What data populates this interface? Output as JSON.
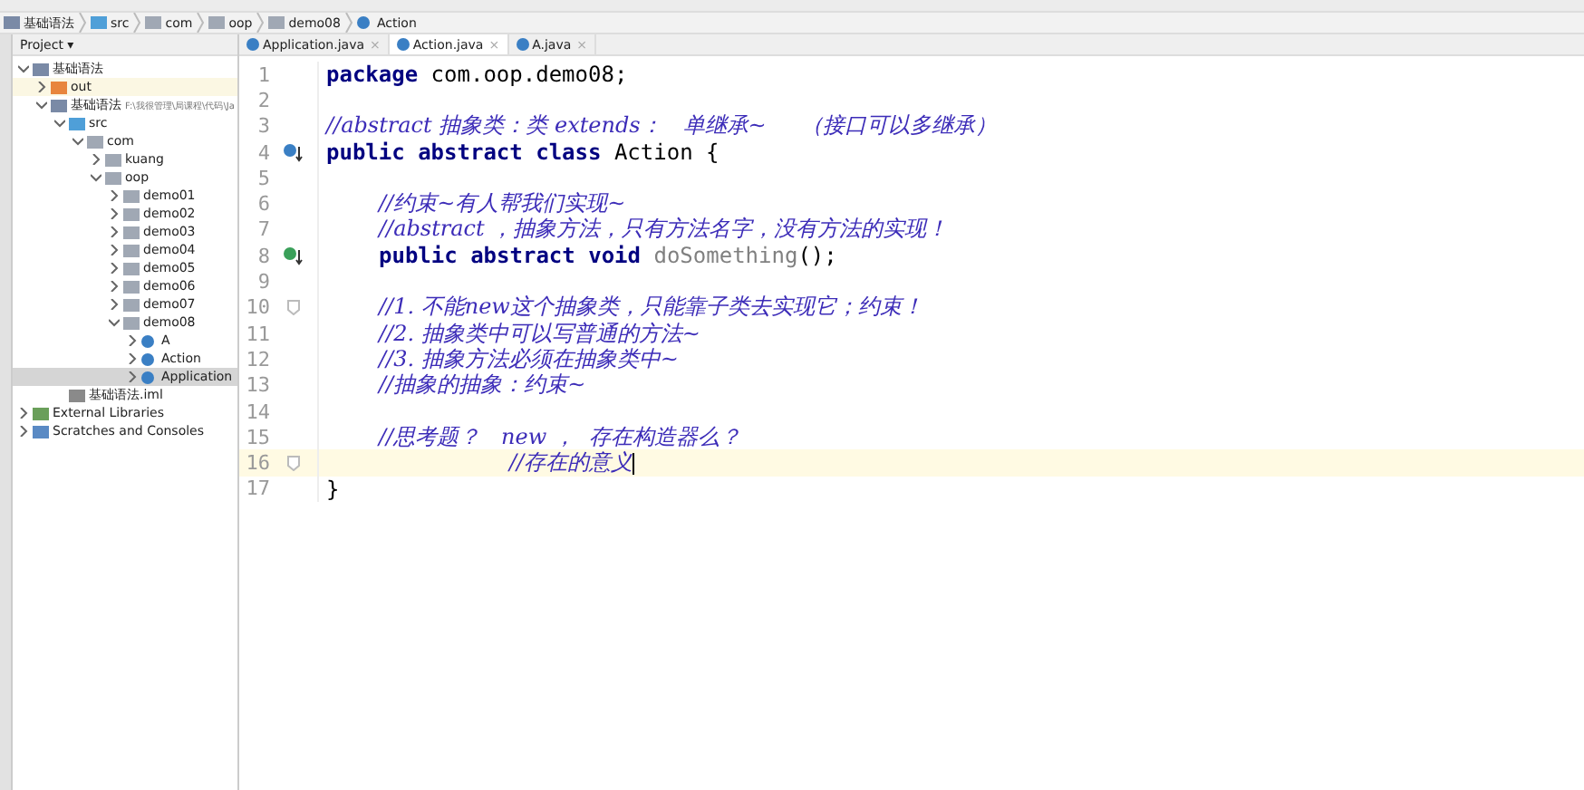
{
  "breadcrumb": [
    {
      "label": "基础语法",
      "kind": "module"
    },
    {
      "label": "src",
      "kind": "src"
    },
    {
      "label": "com",
      "kind": "package"
    },
    {
      "label": "oop",
      "kind": "package"
    },
    {
      "label": "demo08",
      "kind": "package"
    },
    {
      "label": "Action",
      "kind": "class"
    }
  ],
  "project_panel": {
    "title": "Project",
    "menu_arrow": "▾",
    "tree": [
      {
        "label": "基础语法",
        "kind": "module",
        "expanded": true,
        "selected": false,
        "children": [
          {
            "label": "out",
            "kind": "excluded",
            "expanded": false,
            "selected": false
          },
          {
            "label": "基础语法",
            "path": "F:\\我很管理\\局课程\\代码\\Ja",
            "kind": "module",
            "expanded": true,
            "selected": false,
            "children": [
              {
                "label": "src",
                "kind": "src",
                "expanded": true,
                "selected": false,
                "children": [
                  {
                    "label": "com",
                    "kind": "package",
                    "expanded": true,
                    "selected": false,
                    "children": [
                      {
                        "label": "kuang",
                        "kind": "package",
                        "expanded": false,
                        "selected": false
                      },
                      {
                        "label": "oop",
                        "kind": "package",
                        "expanded": true,
                        "selected": false,
                        "children": [
                          {
                            "label": "demo01",
                            "kind": "package",
                            "expanded": false,
                            "selected": false
                          },
                          {
                            "label": "demo02",
                            "kind": "package",
                            "expanded": false,
                            "selected": false
                          },
                          {
                            "label": "demo03",
                            "kind": "package",
                            "expanded": false,
                            "selected": false
                          },
                          {
                            "label": "demo04",
                            "kind": "package",
                            "expanded": false,
                            "selected": false
                          },
                          {
                            "label": "demo05",
                            "kind": "package",
                            "expanded": false,
                            "selected": false
                          },
                          {
                            "label": "demo06",
                            "kind": "package",
                            "expanded": false,
                            "selected": false
                          },
                          {
                            "label": "demo07",
                            "kind": "package",
                            "expanded": false,
                            "selected": false
                          },
                          {
                            "label": "demo08",
                            "kind": "package",
                            "expanded": true,
                            "selected": false,
                            "children": [
                              {
                                "label": "A",
                                "kind": "class",
                                "expanded": false,
                                "selected": false
                              },
                              {
                                "label": "Action",
                                "kind": "class",
                                "expanded": false,
                                "selected": false
                              },
                              {
                                "label": "Application",
                                "kind": "class",
                                "expanded": false,
                                "selected": true
                              }
                            ]
                          }
                        ]
                      }
                    ]
                  }
                ]
              },
              {
                "label": "基础语法.iml",
                "kind": "file",
                "leaf": true,
                "selected": false
              }
            ]
          }
        ]
      },
      {
        "label": "External Libraries",
        "kind": "library",
        "expanded": false,
        "selected": false
      },
      {
        "label": "Scratches and Consoles",
        "kind": "scratch",
        "expanded": false,
        "selected": false
      }
    ]
  },
  "tabs": [
    {
      "label": "Application.java",
      "selected": false,
      "close": "×"
    },
    {
      "label": "Action.java",
      "selected": true,
      "close": "×"
    },
    {
      "label": "A.java",
      "selected": false,
      "close": "×"
    }
  ],
  "editor": {
    "lines": [
      {
        "number": "1",
        "current": false,
        "tokens": [
          {
            "kind": "keyword",
            "text": "package"
          },
          {
            "kind": "plain",
            "text": " com.oop.demo08;"
          }
        ]
      },
      {
        "number": "2",
        "current": false
      },
      {
        "number": "3",
        "current": false,
        "tokens": [
          {
            "kind": "comment",
            "text": "//abstract 抽象类：类 extends：   单继承~     （接口可以多继承）"
          }
        ]
      },
      {
        "number": "4",
        "current": false,
        "marker": {
          "color": "#3a7fc4"
        },
        "tokens": [
          {
            "kind": "keyword",
            "text": "public abstract class"
          },
          {
            "kind": "plain",
            "text": " Action {"
          }
        ]
      },
      {
        "number": "5",
        "current": false
      },
      {
        "number": "6",
        "current": false,
        "kind": "member",
        "tokens": [
          {
            "kind": "comment",
            "text": "//约束~有人帮我们实现~"
          }
        ]
      },
      {
        "number": "7",
        "current": false,
        "kind": "member",
        "tokens": [
          {
            "kind": "comment",
            "text": "//abstract ，抽象方法，只有方法名字，没有方法的实现！"
          }
        ]
      },
      {
        "number": "8",
        "current": false,
        "marker": {
          "color": "#3aa05a"
        },
        "kind": "member",
        "tokens": [
          {
            "kind": "keyword",
            "text": "public abstract void"
          },
          {
            "kind": "unused",
            "text": " doSomething"
          },
          {
            "kind": "plain",
            "text": "();"
          }
        ]
      },
      {
        "number": "9",
        "current": false
      },
      {
        "number": "10",
        "current": false,
        "fold": true,
        "kind": "member",
        "tokens": [
          {
            "kind": "comment",
            "text": "//1. 不能new这个抽象类，只能靠子类去实现它；约束！"
          }
        ]
      },
      {
        "number": "11",
        "current": false,
        "kind": "member",
        "tokens": [
          {
            "kind": "comment",
            "text": "//2. 抽象类中可以写普通的方法~"
          }
        ]
      },
      {
        "number": "12",
        "current": false,
        "kind": "member",
        "tokens": [
          {
            "kind": "comment",
            "text": "//3. 抽象方法必须在抽象类中~"
          }
        ]
      },
      {
        "number": "13",
        "current": false,
        "kind": "member",
        "tokens": [
          {
            "kind": "comment",
            "text": "//抽象的抽象：约束~"
          }
        ]
      },
      {
        "number": "14",
        "current": false
      },
      {
        "number": "15",
        "current": false,
        "kind": "member",
        "tokens": [
          {
            "kind": "comment",
            "text": "//思考题？   new ，  存在构造器么？"
          }
        ]
      },
      {
        "number": "16",
        "current": true,
        "fold": true,
        "caret": true,
        "kind": "wrapped",
        "tokens": [
          {
            "kind": "comment",
            "text": "//存在的意义"
          }
        ]
      },
      {
        "number": "17",
        "current": false,
        "tokens": [
          {
            "kind": "plain",
            "text": "}"
          }
        ]
      }
    ]
  }
}
